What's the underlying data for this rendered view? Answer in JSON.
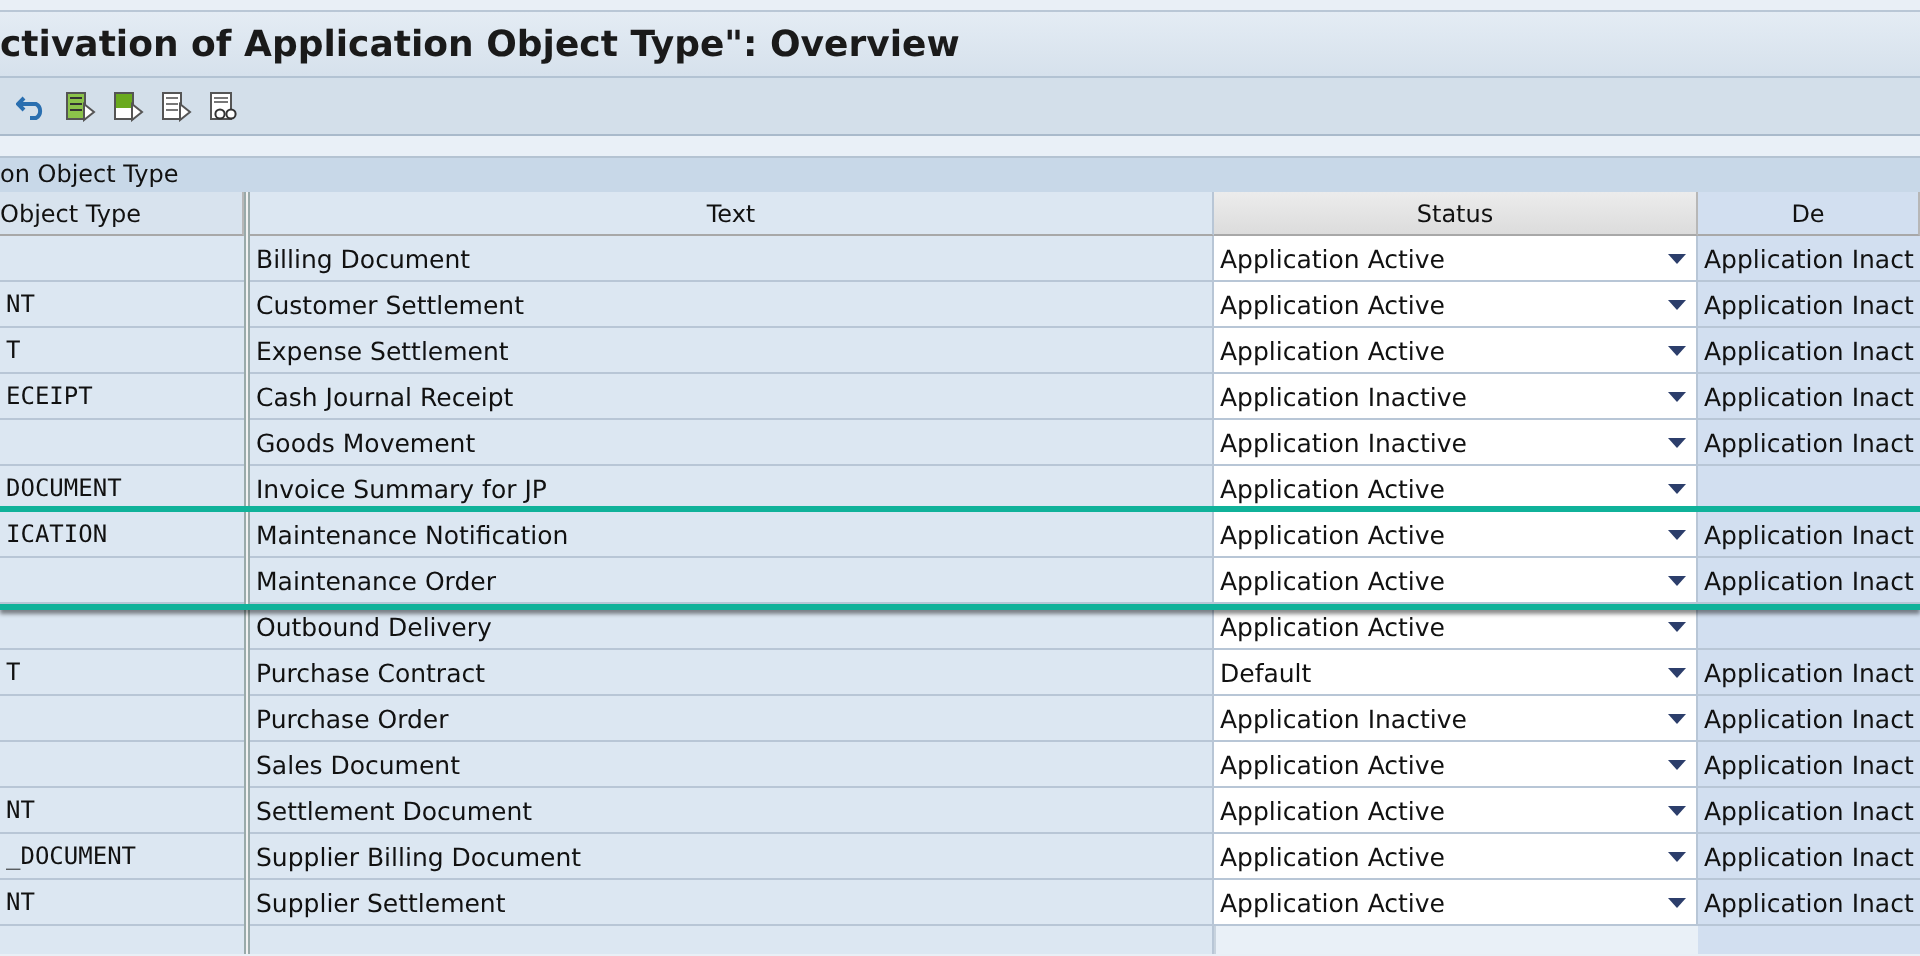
{
  "window": {
    "title": "ctivation of Application Object Type\": Overview"
  },
  "toolbar": {
    "buttons": [
      {
        "kind": "undo"
      },
      {
        "kind": "select-all"
      },
      {
        "kind": "select-block"
      },
      {
        "kind": "deselect"
      },
      {
        "kind": "details"
      }
    ]
  },
  "table": {
    "group_title": "on Object Type",
    "columns": [
      "Object Type",
      "Text",
      "Status",
      "De"
    ],
    "rows": [
      {
        "text": "Billing Document",
        "status": "Application Active",
        "column_4": "Application Inact"
      },
      {
        "object_type": "NT",
        "text": "Customer Settlement",
        "status": "Application Active",
        "column_4": "Application Inact"
      },
      {
        "object_type": "T",
        "text": "Expense Settlement",
        "status": "Application Active",
        "column_4": "Application Inact"
      },
      {
        "object_type": "ECEIPT",
        "text": "Cash Journal Receipt",
        "status": "Application Inactive",
        "column_4": "Application Inact"
      },
      {
        "text": "Goods Movement",
        "status": "Application Inactive",
        "column_4": "Application Inact"
      },
      {
        "object_type": "DOCUMENT",
        "text": "Invoice Summary for JP",
        "status": "Application Active"
      },
      {
        "object_type": "ICATION",
        "text": "Maintenance Notification",
        "status": "Application Active",
        "column_4": "Application Inact",
        "highlighted": true
      },
      {
        "text": "Maintenance Order",
        "status": "Application Active",
        "column_4": "Application Inact",
        "highlighted": true
      },
      {
        "text": "Outbound Delivery",
        "status": "Application Active"
      },
      {
        "object_type": "T",
        "text": "Purchase Contract",
        "status": "Default",
        "column_4": "Application Inact"
      },
      {
        "text": "Purchase Order",
        "status": "Application Inactive",
        "column_4": "Application Inact"
      },
      {
        "text": "Sales Document",
        "status": "Application Active",
        "column_4": "Application Inact"
      },
      {
        "object_type": "NT",
        "text": "Settlement Document",
        "status": "Application Active",
        "column_4": "Application Inact"
      },
      {
        "object_type": "_DOCUMENT",
        "text": "Supplier Billing Document",
        "status": "Application Active",
        "column_4": "Application Inact"
      },
      {
        "object_type": "NT",
        "text": "Supplier Settlement",
        "status": "Application Active",
        "column_4": "Application Inact"
      }
    ]
  }
}
